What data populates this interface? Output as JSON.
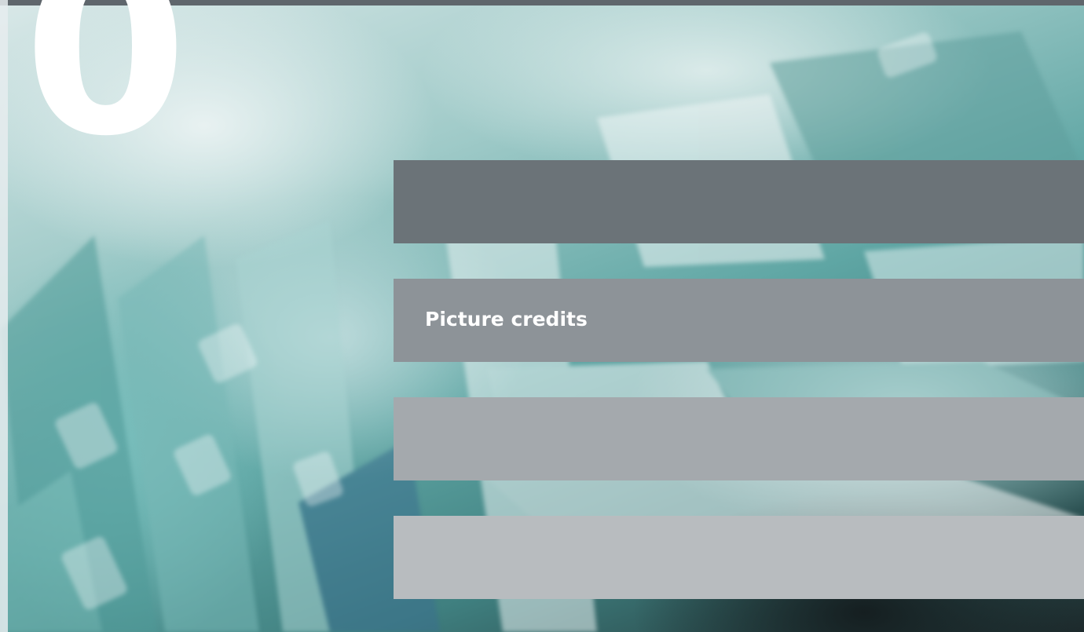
{
  "chapter": {
    "number": "0"
  },
  "section": {
    "title": "Picture credits"
  }
}
